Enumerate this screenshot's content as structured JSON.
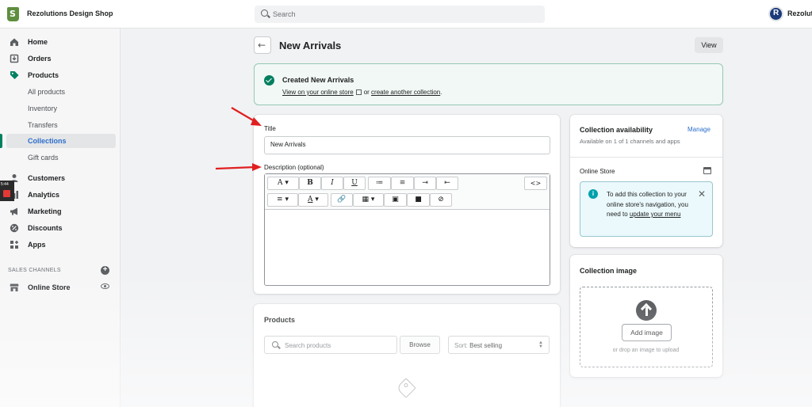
{
  "topbar": {
    "shop_name": "Rezolutions Design Shop",
    "search_label": "Search",
    "account_name": "Rezolut"
  },
  "sidebar": {
    "items": [
      {
        "label": "Home",
        "icon": "home-icon"
      },
      {
        "label": "Orders",
        "icon": "orders-icon"
      },
      {
        "label": "Products",
        "icon": "tag-icon"
      },
      {
        "label": "All products"
      },
      {
        "label": "Inventory"
      },
      {
        "label": "Transfers"
      },
      {
        "label": "Collections"
      },
      {
        "label": "Gift cards"
      },
      {
        "label": "Customers",
        "icon": "person-icon"
      },
      {
        "label": "Analytics",
        "icon": "bar-chart-icon"
      },
      {
        "label": "Marketing",
        "icon": "megaphone-icon"
      },
      {
        "label": "Discounts",
        "icon": "discount-icon"
      },
      {
        "label": "Apps",
        "icon": "apps-icon"
      }
    ],
    "sales_channels_heading": "SALES CHANNELS",
    "online_store_label": "Online Store",
    "recording_time": "5:44"
  },
  "page": {
    "title": "New Arrivals",
    "view_label": "View"
  },
  "banner": {
    "title": "Created New Arrivals",
    "view_link": "View on your online store",
    "or_text": "or",
    "create_link": "create another collection",
    "period": "."
  },
  "details": {
    "title_label": "Title",
    "title_value": "New Arrivals",
    "description_label": "Description (optional)",
    "toolbar_row1": [
      "A",
      "B",
      "I",
      "U",
      "≔",
      "≡",
      "⇥",
      "⇤",
      "<>"
    ],
    "toolbar_row2": [
      "≡",
      "A",
      "🔗",
      "▦",
      "▣",
      "■",
      "⊘"
    ]
  },
  "availability": {
    "title": "Collection availability",
    "manage_label": "Manage",
    "subtitle": "Available on 1 of 1 channels and apps",
    "channel_name": "Online Store",
    "info_text": "To add this collection to your online store's navigation, you need to",
    "info_link": "update your menu"
  },
  "collection_image": {
    "title": "Collection image",
    "add_button": "Add image",
    "drop_hint": "or drop an image to upload"
  },
  "products": {
    "title": "Products",
    "search_placeholder": "Search products",
    "browse_label": "Browse",
    "sort_prefix": "Sort:",
    "sort_value": "Best selling"
  },
  "colors": {
    "accent_green": "#008060",
    "link_blue": "#2c6ecb",
    "banner_bg": "#f1f8f5",
    "info_bg": "#ebf9fc",
    "arrow_red": "#e02020"
  }
}
